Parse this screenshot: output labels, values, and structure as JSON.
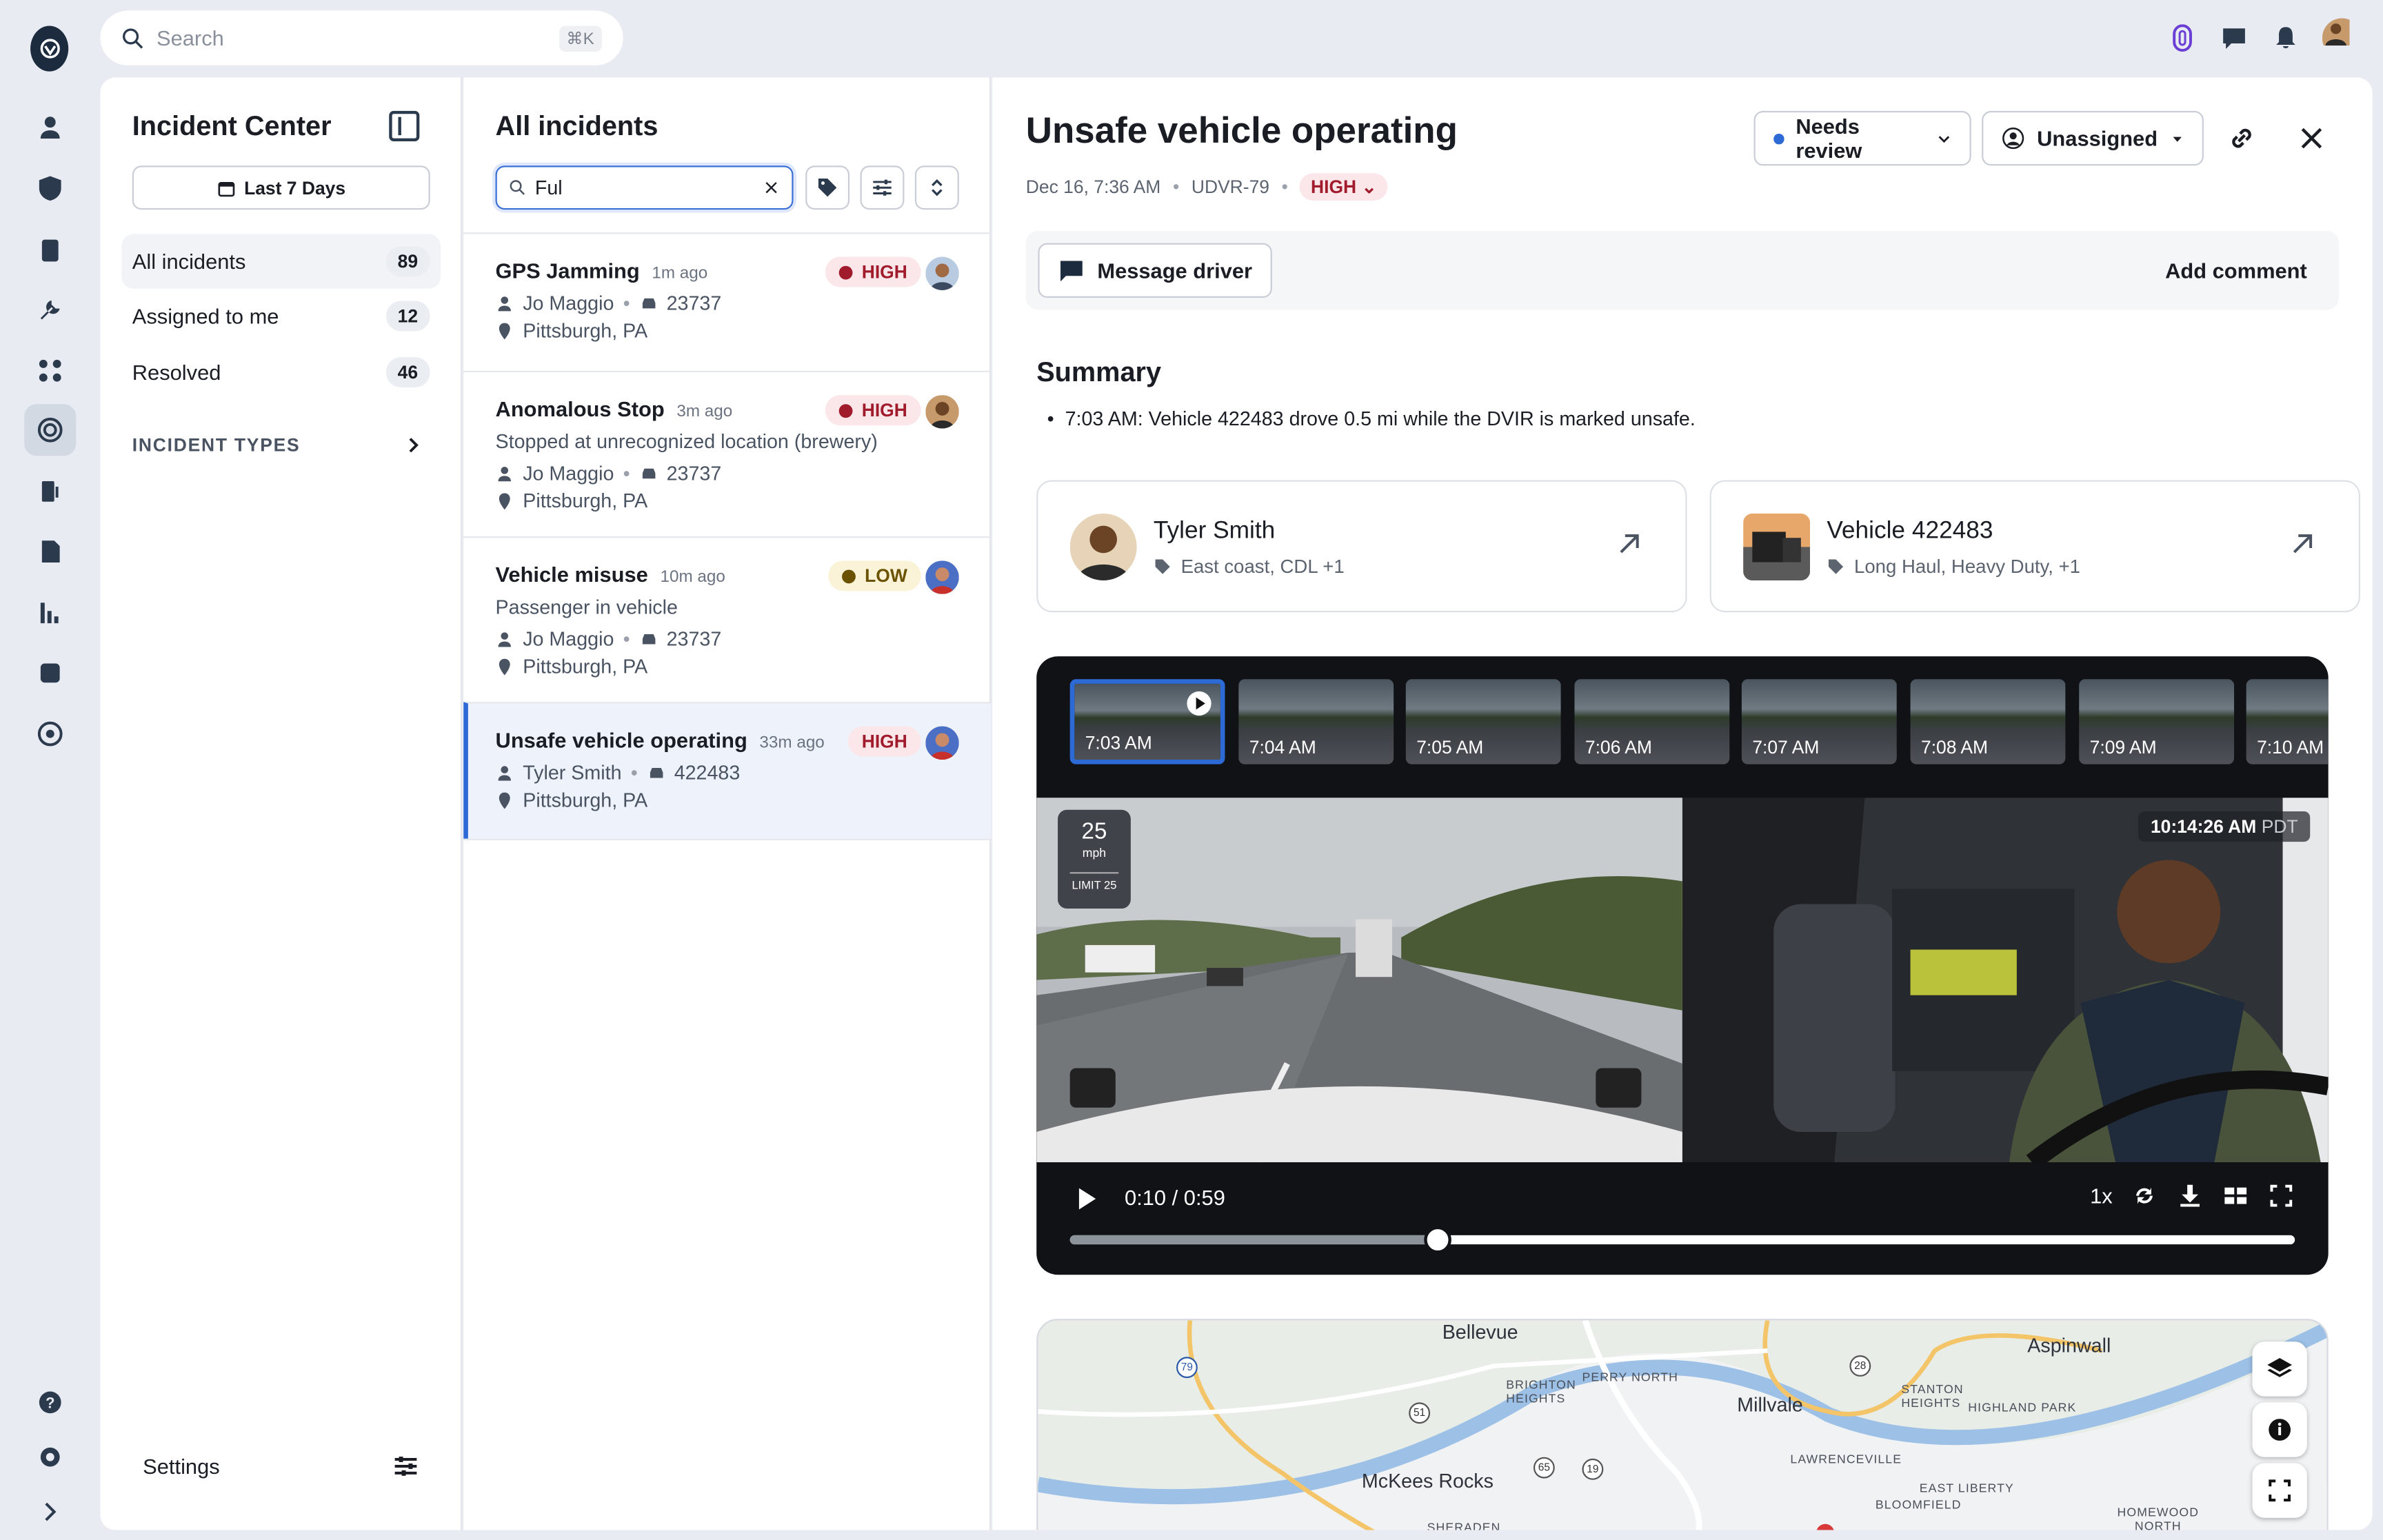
{
  "topbar": {
    "search_placeholder": "Search",
    "shortcut": "⌘K"
  },
  "sidebar": {
    "title": "Incident Center",
    "date_filter": "Last 7 Days",
    "items": [
      {
        "label": "All incidents",
        "count": "89"
      },
      {
        "label": "Assigned to me",
        "count": "12"
      },
      {
        "label": "Resolved",
        "count": "46"
      }
    ],
    "types_label": "INCIDENT TYPES",
    "settings_label": "Settings"
  },
  "list": {
    "title": "All incidents",
    "filter_value": "Ful",
    "incidents": [
      {
        "title": "GPS Jamming",
        "ago": "1m ago",
        "severity": "HIGH",
        "desc": "",
        "driver": "Jo Maggio",
        "vehicle": "23737",
        "location": "Pittsburgh, PA"
      },
      {
        "title": "Anomalous Stop",
        "ago": "3m ago",
        "severity": "HIGH",
        "desc": "Stopped at unrecognized location (brewery)",
        "driver": "Jo Maggio",
        "vehicle": "23737",
        "location": "Pittsburgh, PA"
      },
      {
        "title": "Vehicle misuse",
        "ago": "10m ago",
        "severity": "LOW",
        "desc": "Passenger in vehicle",
        "driver": "Jo Maggio",
        "vehicle": "23737",
        "location": "Pittsburgh, PA"
      },
      {
        "title": "Unsafe vehicle operating",
        "ago": "33m ago",
        "severity": "HIGH",
        "desc": "",
        "driver": "Tyler Smith",
        "vehicle": "422483",
        "location": "Pittsburgh, PA"
      }
    ]
  },
  "detail": {
    "title": "Unsafe vehicle operating",
    "date": "Dec 16, 7:36 AM",
    "id": "UDVR-79",
    "severity": "HIGH",
    "status": "Needs review",
    "assignee": "Unassigned",
    "message_driver": "Message driver",
    "add_comment": "Add comment",
    "summary_title": "Summary",
    "summary_text": "7:03 AM: Vehicle 422483 drove 0.5 mi while the DVIR is marked unsafe.",
    "driver": {
      "name": "Tyler Smith",
      "tags": "East coast, CDL +1"
    },
    "vehicle": {
      "name": "Vehicle 422483",
      "tags": "Long Haul, Heavy Duty, +1"
    }
  },
  "video": {
    "thumbs": [
      "7:03 AM",
      "7:04 AM",
      "7:05 AM",
      "7:06 AM",
      "7:07 AM",
      "7:08 AM",
      "7:09 AM",
      "7:10 AM"
    ],
    "speed": "25",
    "speed_unit": "mph",
    "limit": "LIMIT 25",
    "timestamp": "10:14:26 AM",
    "tz": "PDT",
    "time": "0:10 / 0:59",
    "rate": "1x",
    "progress": 0.3
  },
  "map": {
    "labels": {
      "bellevue": "Bellevue",
      "aspinwall": "Aspinwall",
      "brighton": "BRIGHTON HEIGHTS",
      "perry": "PERRY NORTH",
      "millvale": "Millvale",
      "stanton": "STANTON HEIGHTS",
      "highland": "HIGHLAND PARK",
      "lawrenceville": "LAWRENCEVILLE",
      "mckees": "McKees Rocks",
      "eastliberty": "EAST LIBERTY",
      "bloomfield": "BLOOMFIELD",
      "homewood": "HOMEWOOD NORTH",
      "sheraden": "SHERADEN"
    },
    "shields": {
      "r79": "79",
      "r28": "28",
      "r51": "51",
      "r65": "65",
      "r19": "19"
    }
  },
  "colors": {
    "accent": "#2d6ad6",
    "high": "#a01b2b",
    "low": "#6b5200"
  }
}
